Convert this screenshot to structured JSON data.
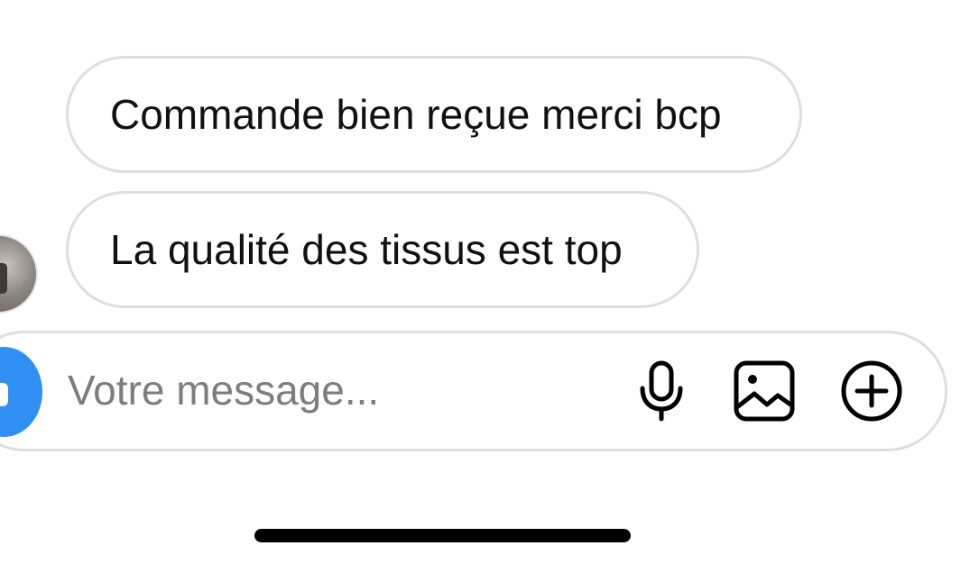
{
  "messages": [
    {
      "text": "Commande bien reçue merci bcp"
    },
    {
      "text": "La qualité des tissus est top"
    }
  ],
  "composer": {
    "placeholder": "Votre message...",
    "value": ""
  },
  "icons": {
    "camera": "camera-icon",
    "microphone": "microphone-icon",
    "gallery": "image-gallery-icon",
    "add": "plus-circle-icon"
  },
  "colors": {
    "camera_button": "#2f8ff2",
    "bubble_border": "#dedede",
    "placeholder_text": "#7d7d7d"
  }
}
